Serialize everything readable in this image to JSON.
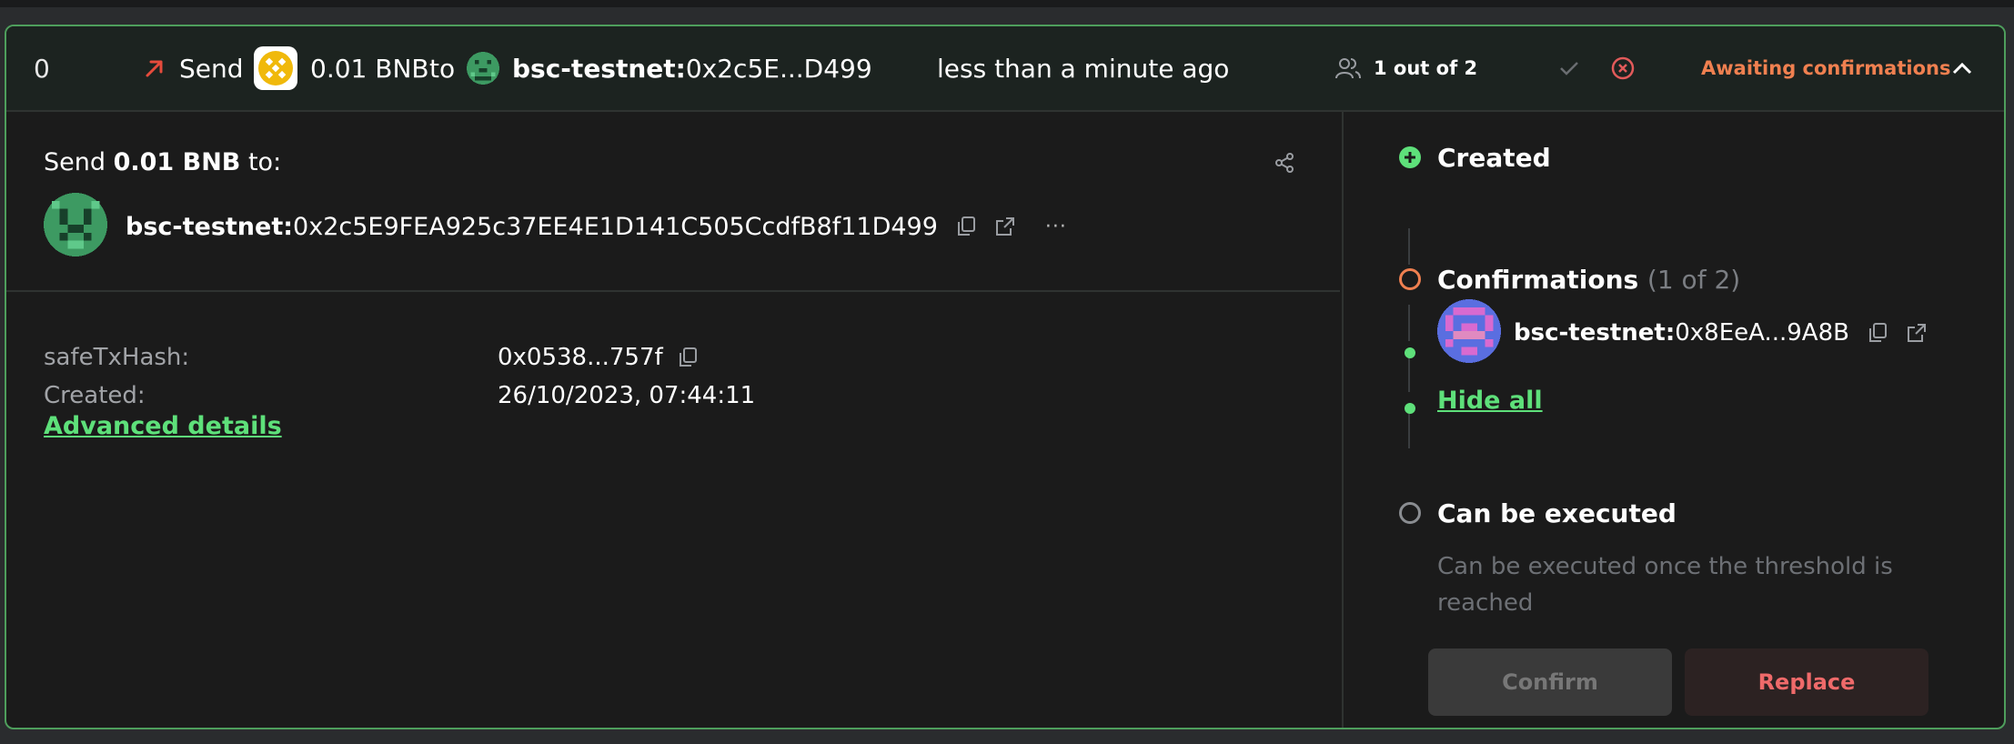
{
  "summary": {
    "nonce": "0",
    "type_label": "Send",
    "amount": "0.01 BNB",
    "to_word": "to",
    "recipient_prefix": "bsc-testnet:",
    "recipient_short": "0x2c5E...D499",
    "age": "less than a minute ago",
    "signers": "1 out of 2",
    "status": "Awaiting confirmations"
  },
  "details": {
    "send_prefix": "Send ",
    "send_amount": "0.01 BNB",
    "send_suffix": " to:",
    "recipient_prefix": "bsc-testnet:",
    "recipient_full": "0x2c5E9FEA925c37EE4E1D141C505CcdfB8f11D499",
    "more": "···",
    "fields": [
      {
        "label": "safeTxHash:",
        "value": "0x0538...757f"
      },
      {
        "label": "Created:",
        "value": "26/10/2023, 07:44:11"
      }
    ],
    "advanced_link": "Advanced details"
  },
  "timeline": {
    "created": "Created",
    "confirmations": "Confirmations",
    "confirmations_count": "(1 of 2)",
    "owner_prefix": "bsc-testnet:",
    "owner_short": "0x8EeA...9A8B",
    "hide_all": "Hide all",
    "can_execute": "Can be executed",
    "execute_note": "Can be executed once the threshold is reached"
  },
  "buttons": {
    "confirm": "Confirm",
    "replace": "Replace"
  },
  "colors": {
    "accent_green": "#5ee07a",
    "status_orange": "#f08050",
    "reject_red": "#e25a5a",
    "send_arrow": "#e54b3c",
    "border_green": "#4e9e5c"
  },
  "icons": [
    "send-arrow-icon",
    "bnb-logo",
    "identicon",
    "signers-icon",
    "check-icon",
    "reject-icon",
    "chevron-up-icon",
    "share-icon",
    "copy-icon",
    "external-link-icon",
    "more-icon"
  ]
}
